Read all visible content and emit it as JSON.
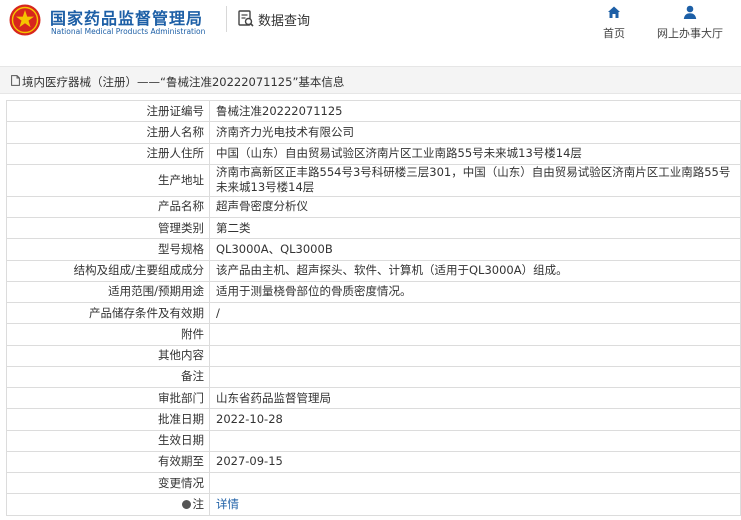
{
  "header": {
    "title": "国家药品监督管理局",
    "subtitle": "National Medical Products Administration",
    "query_label": "数据查询",
    "nav": [
      {
        "label": "首页",
        "icon": "home-icon"
      },
      {
        "label": "网上办事大厅",
        "icon": "user-icon"
      }
    ]
  },
  "breadcrumb": {
    "text": "境内医疗器械（注册）——“鲁械注准20222071125”基本信息"
  },
  "colors": {
    "brand_blue": "#1d5fa6",
    "logo_red": "#d7261e",
    "border": "#dcdcdc"
  },
  "rows": [
    {
      "label": "注册证编号",
      "value": "鲁械注准20222071125"
    },
    {
      "label": "注册人名称",
      "value": "济南齐力光电技术有限公司"
    },
    {
      "label": "注册人住所",
      "value": "中国（山东）自由贸易试验区济南片区工业南路55号未来城13号楼14层"
    },
    {
      "label": "生产地址",
      "value": "济南市高新区正丰路554号3号科研楼三层301，中国（山东）自由贸易试验区济南片区工业南路55号未来城13号楼14层"
    },
    {
      "label": "产品名称",
      "value": "超声骨密度分析仪"
    },
    {
      "label": "管理类别",
      "value": "第二类"
    },
    {
      "label": "型号规格",
      "value": "QL3000A、QL3000B"
    },
    {
      "label": "结构及组成/主要组成成分",
      "value": "该产品由主机、超声探头、软件、计算机（适用于QL3000A）组成。"
    },
    {
      "label": "适用范围/预期用途",
      "value": "适用于测量桡骨部位的骨质密度情况。"
    },
    {
      "label": "产品储存条件及有效期",
      "value": "/"
    },
    {
      "label": "附件",
      "value": ""
    },
    {
      "label": "其他内容",
      "value": ""
    },
    {
      "label": "备注",
      "value": ""
    },
    {
      "label": "审批部门",
      "value": "山东省药品监督管理局"
    },
    {
      "label": "批准日期",
      "value": "2022-10-28"
    },
    {
      "label": "生效日期",
      "value": ""
    },
    {
      "label": "有效期至",
      "value": "2027-09-15"
    },
    {
      "label": "变更情况",
      "value": ""
    },
    {
      "label": "注",
      "value": "详情"
    }
  ]
}
